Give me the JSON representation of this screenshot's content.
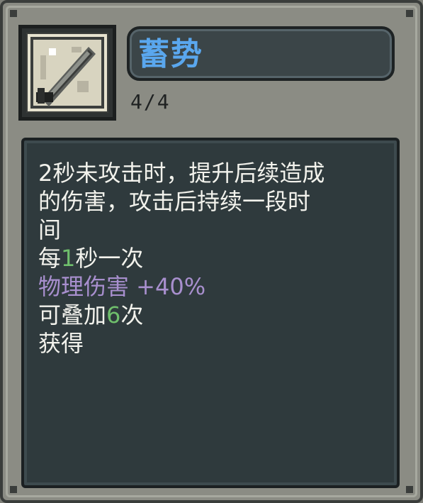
{
  "skill": {
    "name": "蓄势",
    "stacks": "4/4",
    "icon": "sword-icon",
    "description_lines": [
      "2秒未攻击时，提升后续造成",
      "的伤害，攻击后持续一段时",
      "间"
    ],
    "freq_prefix": "每",
    "freq_value": "1",
    "freq_suffix": "秒一次",
    "effect_text": "物理伤害 +40%",
    "stack_prefix": "可叠加",
    "stack_value": "6",
    "stack_suffix": "次",
    "obtain_label": "获得"
  },
  "colors": {
    "title": "#5aa7ee",
    "highlight_number": "#6fbf6c",
    "effect": "#a88fce",
    "text": "#f2f2ec"
  }
}
